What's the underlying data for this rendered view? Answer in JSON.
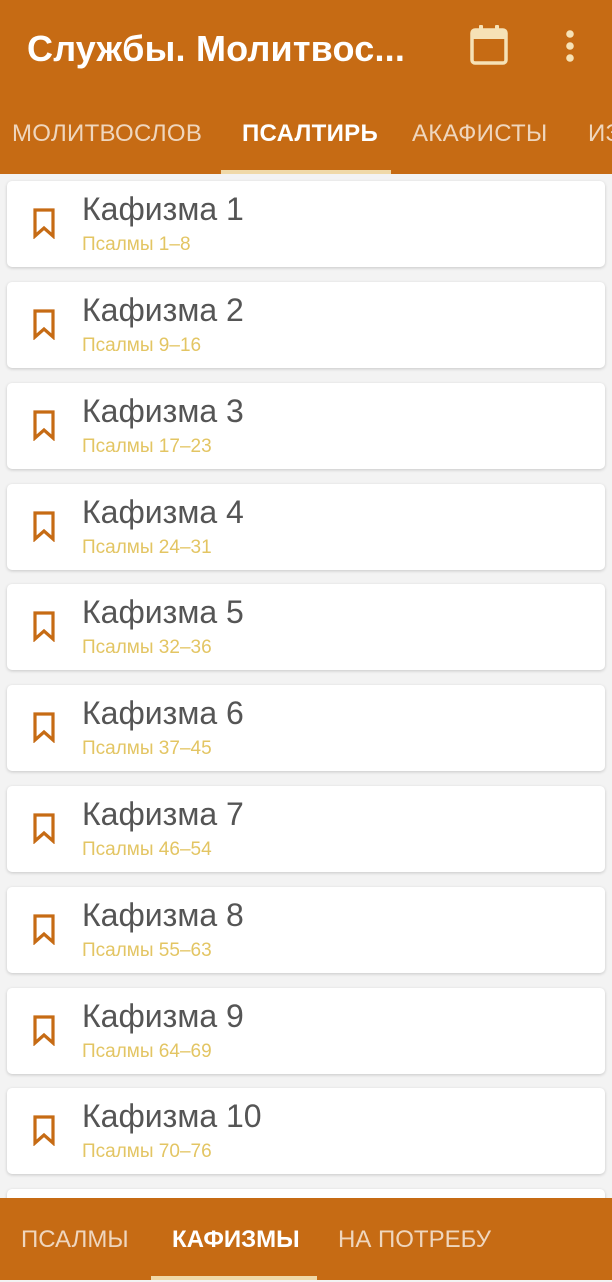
{
  "appbar": {
    "title": "Службы. Молитвос...",
    "calendar_icon": "calendar-icon",
    "more_icon": "more-vert-icon"
  },
  "top_tabs": [
    {
      "label": "Молитвослов",
      "active": false
    },
    {
      "label": "Псалтирь",
      "active": true
    },
    {
      "label": "Акафисты",
      "active": false
    },
    {
      "label": "Из",
      "active": false
    }
  ],
  "kathismas": [
    {
      "title": "Кафизма 1",
      "subtitle": "Псалмы 1–8"
    },
    {
      "title": "Кафизма 2",
      "subtitle": "Псалмы 9–16"
    },
    {
      "title": "Кафизма 3",
      "subtitle": "Псалмы 17–23"
    },
    {
      "title": "Кафизма 4",
      "subtitle": "Псалмы 24–31"
    },
    {
      "title": "Кафизма 5",
      "subtitle": "Псалмы 32–36"
    },
    {
      "title": "Кафизма 6",
      "subtitle": "Псалмы 37–45"
    },
    {
      "title": "Кафизма 7",
      "subtitle": "Псалмы 46–54"
    },
    {
      "title": "Кафизма 8",
      "subtitle": "Псалмы 55–63"
    },
    {
      "title": "Кафизма 9",
      "subtitle": "Псалмы 64–69"
    },
    {
      "title": "Кафизма 10",
      "subtitle": "Псалмы 70–76"
    }
  ],
  "bottom_tabs": [
    {
      "label": "Псалмы",
      "active": false
    },
    {
      "label": "Кафизмы",
      "active": true
    },
    {
      "label": "На потребу",
      "active": false
    }
  ],
  "colors": {
    "brand": "#c66b14",
    "subtitle": "#e3c563",
    "indicator": "#f0d9a8"
  }
}
